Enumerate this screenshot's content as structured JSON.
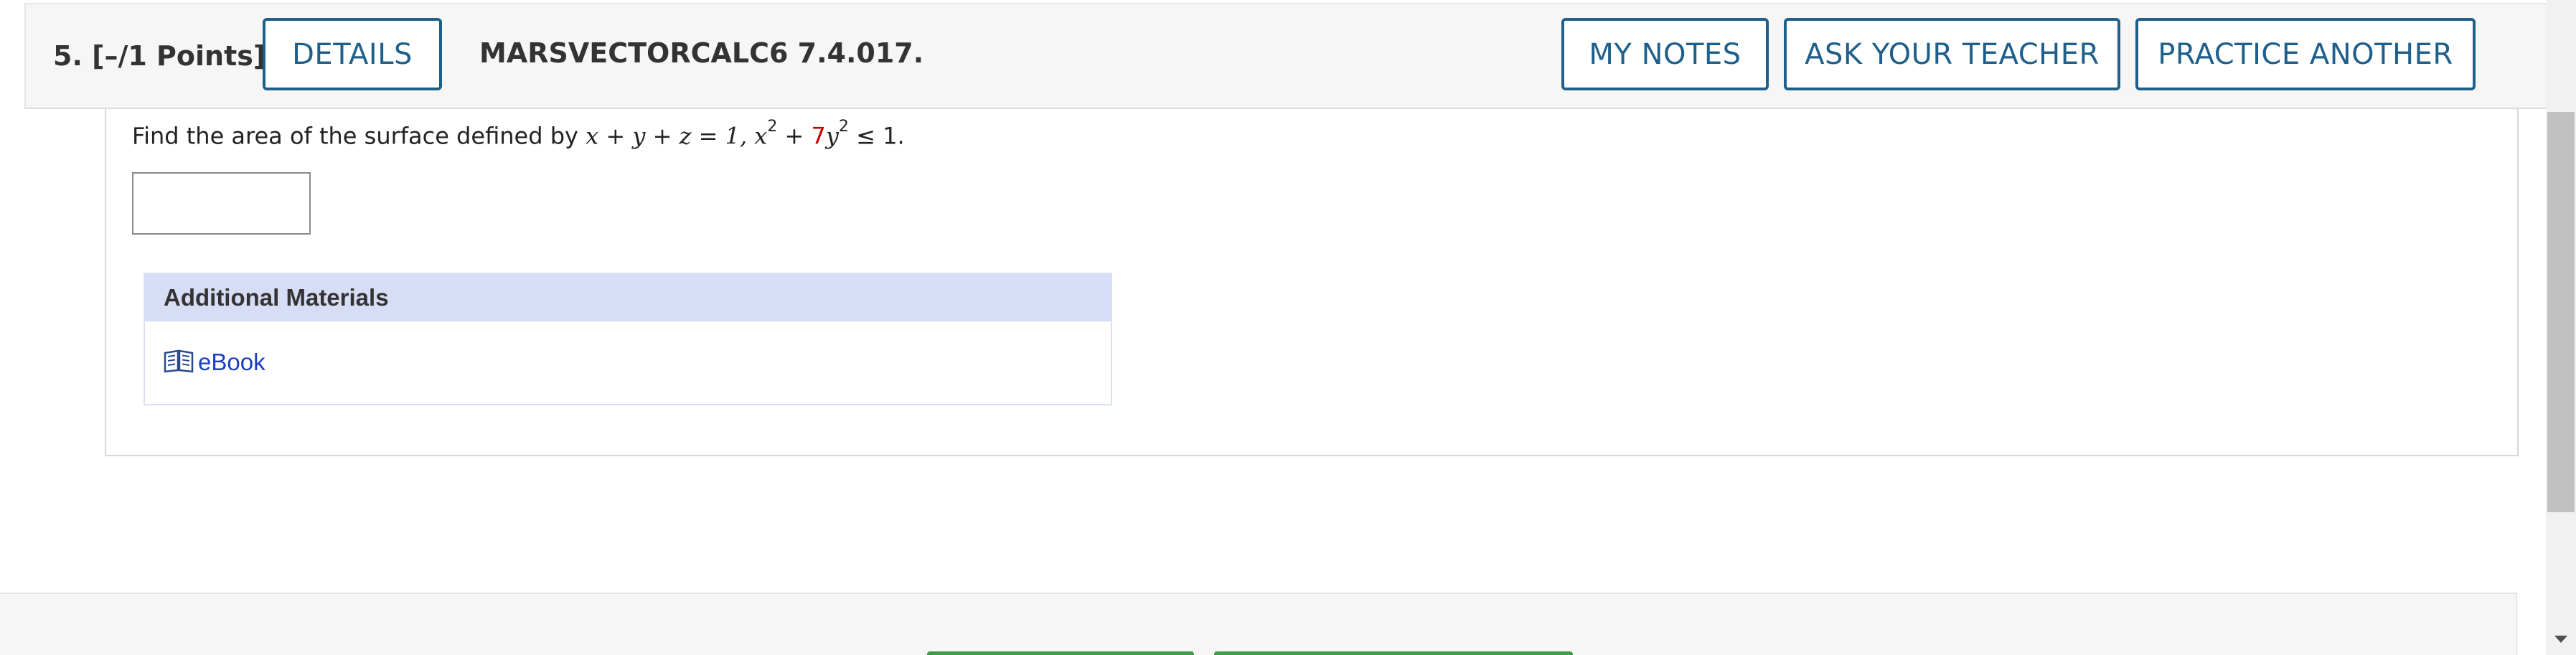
{
  "header": {
    "question_number": "5.",
    "points": "[–/1 Points]",
    "details_label": "DETAILS",
    "problem_code": "MARSVECTORCALC6 7.4.017.",
    "my_notes_label": "MY NOTES",
    "ask_teacher_label": "ASK YOUR TEACHER",
    "practice_label": "PRACTICE ANOTHER"
  },
  "question": {
    "prefix": "Find the area of the surface defined by",
    "eq1": "x + y + z = 1,",
    "x_var": "x",
    "exp1": "2",
    "plus": "+",
    "coef": "7",
    "y_var": "y",
    "exp2": "2",
    "ineq": "≤ 1."
  },
  "answer": {
    "value": ""
  },
  "materials": {
    "heading": "Additional Materials",
    "ebook_label": "eBook",
    "ebook_icon": "book-icon"
  },
  "colors": {
    "accent": "#1f5f8b",
    "materials_header_bg": "#d7ddf5",
    "link": "#1a3fbf",
    "coefficient_red": "#cc0000"
  }
}
